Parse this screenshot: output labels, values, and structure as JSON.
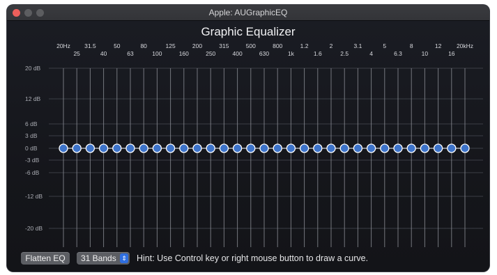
{
  "window": {
    "title": "Apple: AUGraphicEQ"
  },
  "eq": {
    "heading": "Graphic Equalizer",
    "freq_labels_top": [
      "20Hz",
      "31.5",
      "50",
      "80",
      "125",
      "200",
      "315",
      "500",
      "800",
      "1.2",
      "2",
      "3.1",
      "5",
      "8",
      "12",
      "20kHz"
    ],
    "freq_labels_bottom": [
      "25",
      "40",
      "63",
      "100",
      "160",
      "250",
      "400",
      "630",
      "1k",
      "1.6",
      "2.5",
      "4",
      "6.3",
      "10",
      "16"
    ],
    "db_labels": [
      "20 dB",
      "12 dB",
      "6 dB",
      "3 dB",
      "0 dB",
      "-3 dB",
      "-6 dB",
      "-12 dB",
      "-20 dB"
    ],
    "band_count": 31,
    "band_gains_db": [
      0,
      0,
      0,
      0,
      0,
      0,
      0,
      0,
      0,
      0,
      0,
      0,
      0,
      0,
      0,
      0,
      0,
      0,
      0,
      0,
      0,
      0,
      0,
      0,
      0,
      0,
      0,
      0,
      0,
      0,
      0
    ],
    "colors": {
      "knob": "#3d73c9",
      "knob_ring": "#ffffff",
      "line": "#cfd2d8",
      "grid": "#3b3e46"
    }
  },
  "controls": {
    "flatten_label": "Flatten EQ",
    "bands_label": "31 Bands",
    "hint": "Hint: Use Control key or right mouse button to draw a curve."
  }
}
